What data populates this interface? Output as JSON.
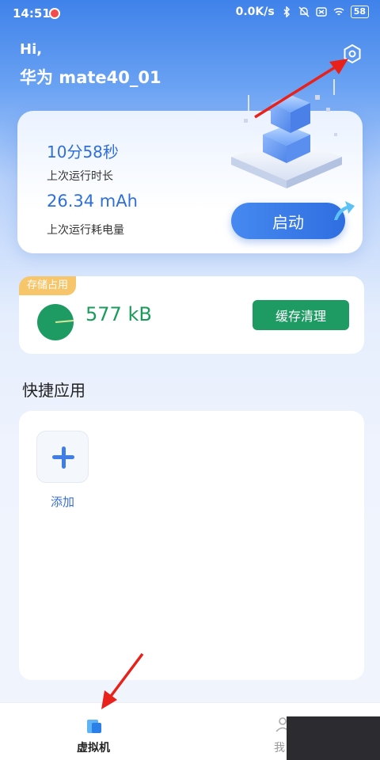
{
  "status_bar": {
    "time": "14:51",
    "network_speed": "0.0K/s",
    "battery": "58"
  },
  "header": {
    "greeting": "Hi,",
    "device_name": "华为 mate40_01"
  },
  "run_card": {
    "duration": "10分58秒",
    "duration_label": "上次运行时长",
    "power": "26.34 mAh",
    "power_label": "上次运行耗电量",
    "launch_label": "启动"
  },
  "storage": {
    "tag": "存储占用",
    "size": "577 kB",
    "clean_label": "缓存清理"
  },
  "quick_apps": {
    "title": "快捷应用",
    "add_label": "添加"
  },
  "bottom_nav": {
    "items": [
      {
        "label": "虚拟机",
        "icon": "vm-icon",
        "active": true
      },
      {
        "label": "我",
        "icon": "person-icon",
        "active": false
      }
    ]
  },
  "colors": {
    "primary": "#2f6fd8",
    "storage_green": "#1e9b63",
    "tag_orange": "#f8c66a",
    "annotation_red": "#e8221b"
  }
}
